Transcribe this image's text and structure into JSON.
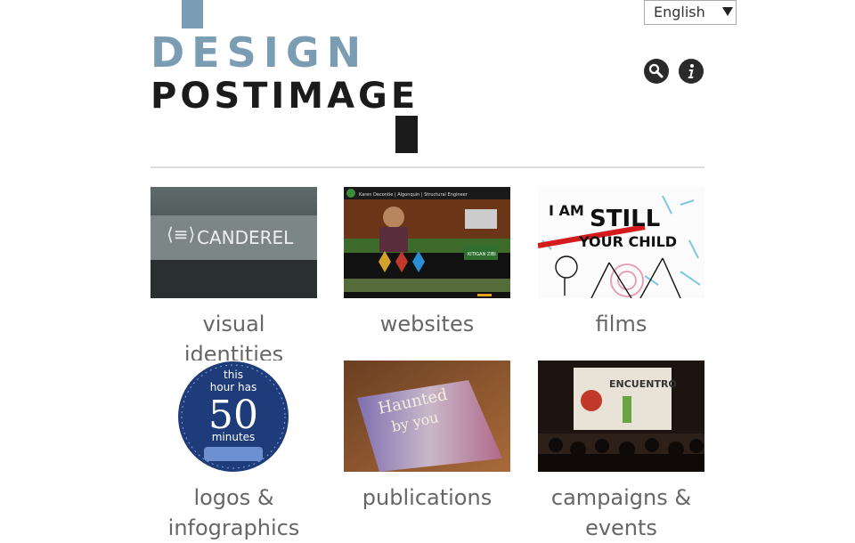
{
  "language": {
    "selected": "English"
  },
  "logo": {
    "line1": "DESIGN",
    "line2": "POSTIMAGE"
  },
  "icons": {
    "search": "search-icon",
    "info": "info-icon"
  },
  "tiles": [
    {
      "label": "visual identities",
      "thumb_text": "CANDEREL"
    },
    {
      "label": "websites",
      "thumb_text": "Karen Decontie | Algonquin | Structural Engineer",
      "thumb_badge": "KITIGAN ZIBI"
    },
    {
      "label": "films",
      "thumb_line1": "I AM",
      "thumb_line2": "STILL",
      "thumb_line3": "YOUR CHILD"
    },
    {
      "label": "logos & infographics",
      "thumb_line1": "this",
      "thumb_line2": "hour has",
      "thumb_line3": "50",
      "thumb_line4": "minutes"
    },
    {
      "label": "publications",
      "thumb_line1": "Haunted",
      "thumb_line2": "by you"
    },
    {
      "label": "campaigns & events",
      "thumb_text": "ENCUENTRO"
    }
  ],
  "colors": {
    "logo_blue": "#7b9db3",
    "logo_dark": "#1b1b1b",
    "caption": "#666666"
  }
}
